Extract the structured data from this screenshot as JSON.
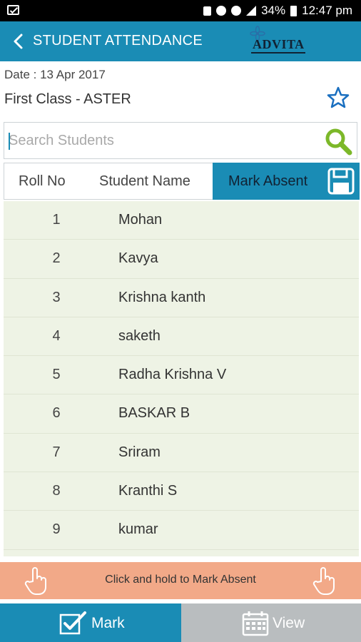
{
  "status_bar": {
    "battery": "34%",
    "time": "12:47 pm"
  },
  "app_bar": {
    "title": "STUDENT ATTENDANCE",
    "logo_text": "ADVITA"
  },
  "info": {
    "date": "Date : 13 Apr 2017",
    "class_name": "First Class - ASTER"
  },
  "search": {
    "placeholder": "Search Students"
  },
  "table": {
    "headers": {
      "roll_no": "Roll No",
      "student_name": "Student Name",
      "mark_absent": "Mark Absent"
    },
    "rows": [
      {
        "roll": "1",
        "name": "Mohan"
      },
      {
        "roll": "2",
        "name": "Kavya"
      },
      {
        "roll": "3",
        "name": "Krishna kanth"
      },
      {
        "roll": "4",
        "name": "saketh"
      },
      {
        "roll": "5",
        "name": "Radha Krishna V"
      },
      {
        "roll": "6",
        "name": "BASKAR B"
      },
      {
        "roll": "7",
        "name": "Sriram"
      },
      {
        "roll": "8",
        "name": "Kranthi S"
      },
      {
        "roll": "9",
        "name": "kumar"
      }
    ]
  },
  "hint": {
    "text": "Click and hold to Mark Absent"
  },
  "bottom_nav": {
    "mark_label": "Mark",
    "view_label": "View",
    "active": "mark"
  },
  "icons": {
    "back": "chevron-left-icon",
    "favorite": "star-outline-icon",
    "search": "magnifier-icon",
    "save": "floppy-disk-icon",
    "hint": "hand-pointer-icon",
    "mark": "checkbox-check-icon",
    "view": "calendar-icon"
  },
  "colors": {
    "primary": "#1a8cb5",
    "row_background": "#eef3e5",
    "hint_background": "#f2a988",
    "inactive_tab": "#b9bdbf",
    "search_icon": "#7cb829"
  }
}
